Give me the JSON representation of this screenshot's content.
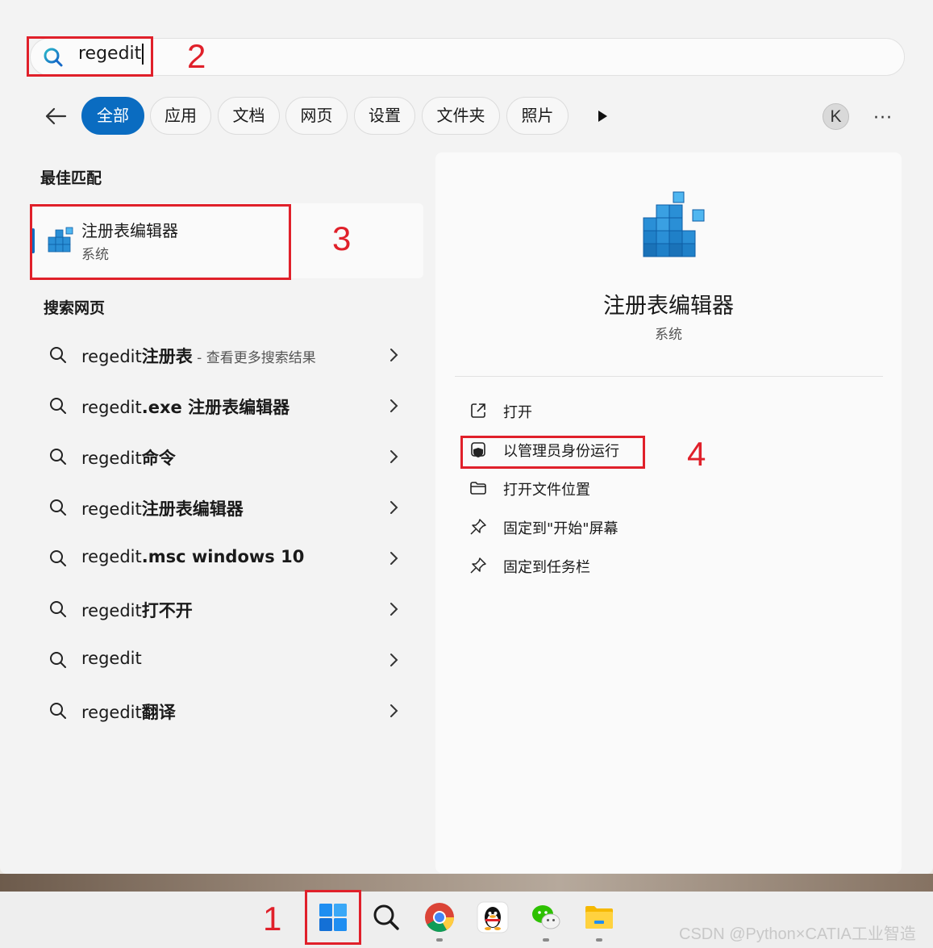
{
  "search": {
    "query": "regedit"
  },
  "filters": {
    "tabs": [
      "全部",
      "应用",
      "文档",
      "网页",
      "设置",
      "文件夹",
      "照片"
    ],
    "active_index": 0,
    "account_initial": "K",
    "more": "···"
  },
  "best_match": {
    "heading": "最佳匹配",
    "app_name": "注册表编辑器",
    "app_type": "系统"
  },
  "web_search": {
    "heading": "搜索网页",
    "items": [
      {
        "query": "regedit",
        "bold": "注册表",
        "note": " - 查看更多搜索结果"
      },
      {
        "query": "regedit",
        "bold": ".exe 注册表编辑器",
        "note": ""
      },
      {
        "query": "regedit",
        "bold": "命令",
        "note": ""
      },
      {
        "query": "regedit",
        "bold": "注册表编辑器",
        "note": ""
      },
      {
        "query": "regedit",
        "bold": ".msc windows 10",
        "note": ""
      },
      {
        "query": "regedit",
        "bold": "打不开",
        "note": ""
      },
      {
        "query": "regedit",
        "bold": "",
        "note": ""
      },
      {
        "query": "regedit",
        "bold": "翻译",
        "note": ""
      }
    ]
  },
  "details": {
    "app_name": "注册表编辑器",
    "app_type": "系统",
    "actions": [
      {
        "label": "打开",
        "icon": "open-external-icon"
      },
      {
        "label": "以管理员身份运行",
        "icon": "shield-admin-icon"
      },
      {
        "label": "打开文件位置",
        "icon": "folder-icon"
      },
      {
        "label": "固定到\"开始\"屏幕",
        "icon": "pin-icon"
      },
      {
        "label": "固定到任务栏",
        "icon": "pin-icon"
      }
    ]
  },
  "annotations": {
    "step1": "1",
    "step2": "2",
    "step3": "3",
    "step4": "4",
    "color": "#e0202a"
  },
  "taskbar": {
    "icons": [
      "windows-start-icon",
      "search-icon",
      "chrome-icon",
      "qq-icon",
      "wechat-icon",
      "file-explorer-icon"
    ]
  },
  "watermark": "CSDN @Python×CATIA工业智造",
  "colors": {
    "accent": "#0a6cc1",
    "panel": "#fafafa",
    "background": "#f3f3f3"
  }
}
